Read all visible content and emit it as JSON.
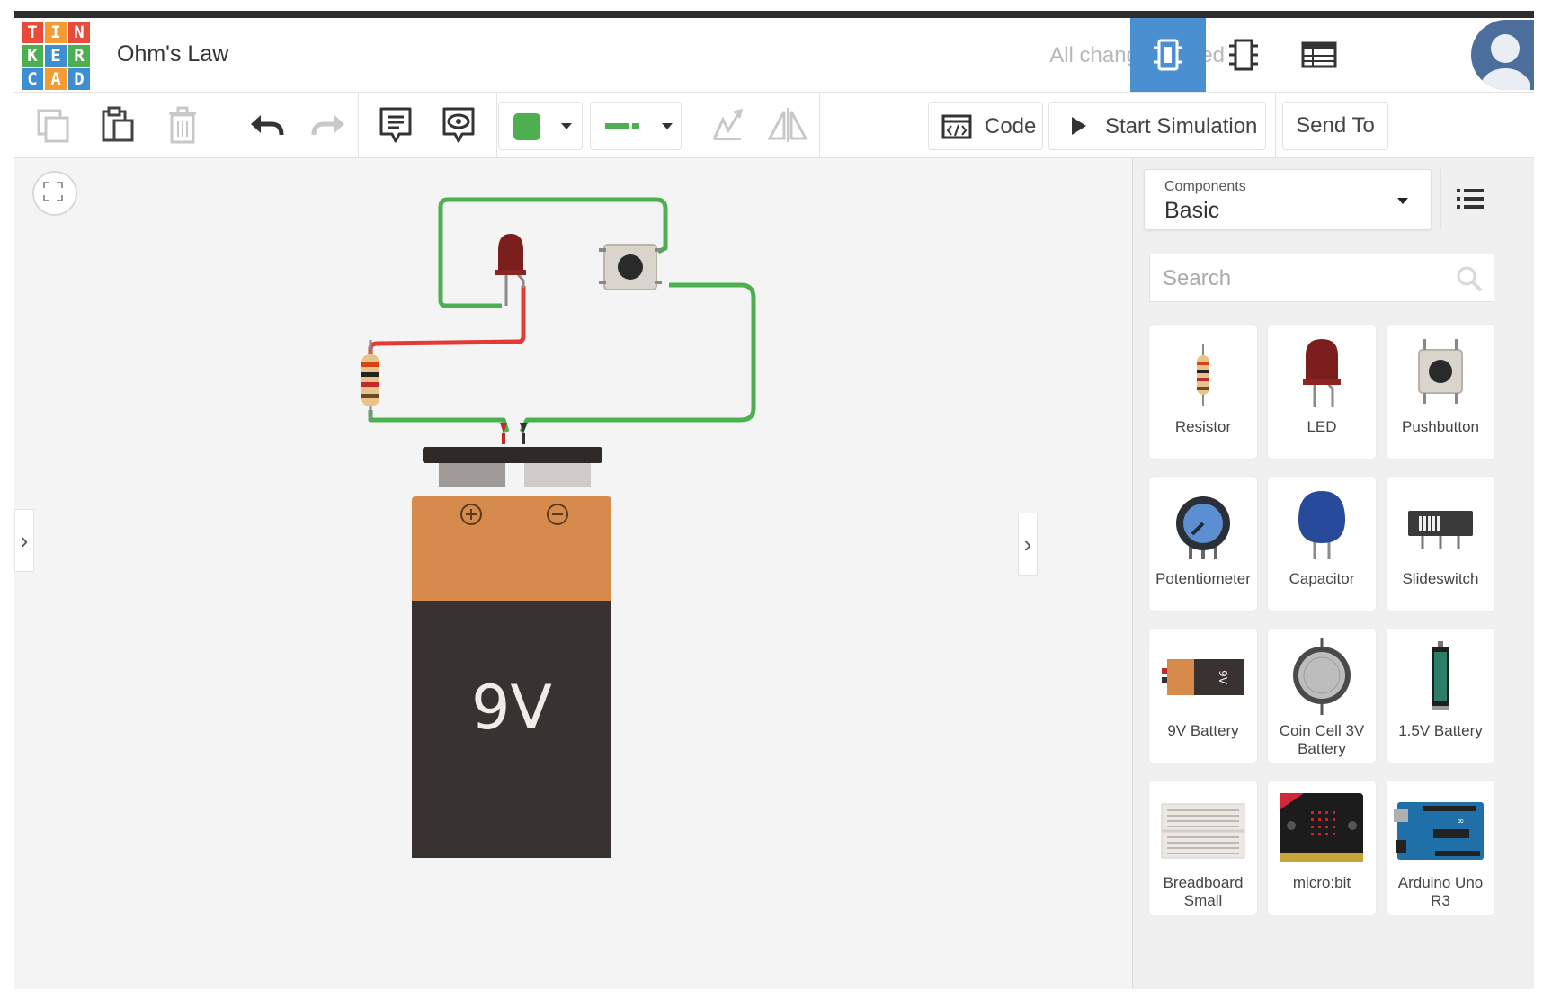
{
  "logo": {
    "letters": [
      "T",
      "I",
      "N",
      "K",
      "E",
      "R",
      "C",
      "A",
      "D"
    ]
  },
  "project": {
    "title": "Ohm's Law",
    "status": "All changes saved"
  },
  "toolbar": {
    "code_label": "Code",
    "simulate_label": "Start Simulation",
    "send_label": "Send To"
  },
  "colors": {
    "accent": "#4a8fcf",
    "wire": "#4caf50",
    "wire_red": "#e53935",
    "battery_top": "#d68a4b",
    "battery_body": "#383330"
  },
  "canvas": {
    "battery_label": "9V",
    "plus": "+",
    "minus": "−"
  },
  "panel": {
    "dropdown_label": "Components",
    "dropdown_value": "Basic",
    "search_placeholder": "Search",
    "components": [
      {
        "label": "Resistor",
        "icon": "resistor-icon"
      },
      {
        "label": "LED",
        "icon": "led-icon"
      },
      {
        "label": "Pushbutton",
        "icon": "pushbutton-icon"
      },
      {
        "label": "Potentiometer",
        "icon": "potentiometer-icon"
      },
      {
        "label": "Capacitor",
        "icon": "capacitor-icon"
      },
      {
        "label": "Slideswitch",
        "icon": "slideswitch-icon"
      },
      {
        "label": "9V Battery",
        "icon": "battery-9v-icon"
      },
      {
        "label": "Coin Cell 3V Battery",
        "icon": "coin-cell-icon"
      },
      {
        "label": "1.5V Battery",
        "icon": "battery-aa-icon"
      },
      {
        "label": "Breadboard Small",
        "icon": "breadboard-icon"
      },
      {
        "label": "micro:bit",
        "icon": "microbit-icon"
      },
      {
        "label": "Arduino Uno R3",
        "icon": "arduino-icon"
      }
    ]
  }
}
